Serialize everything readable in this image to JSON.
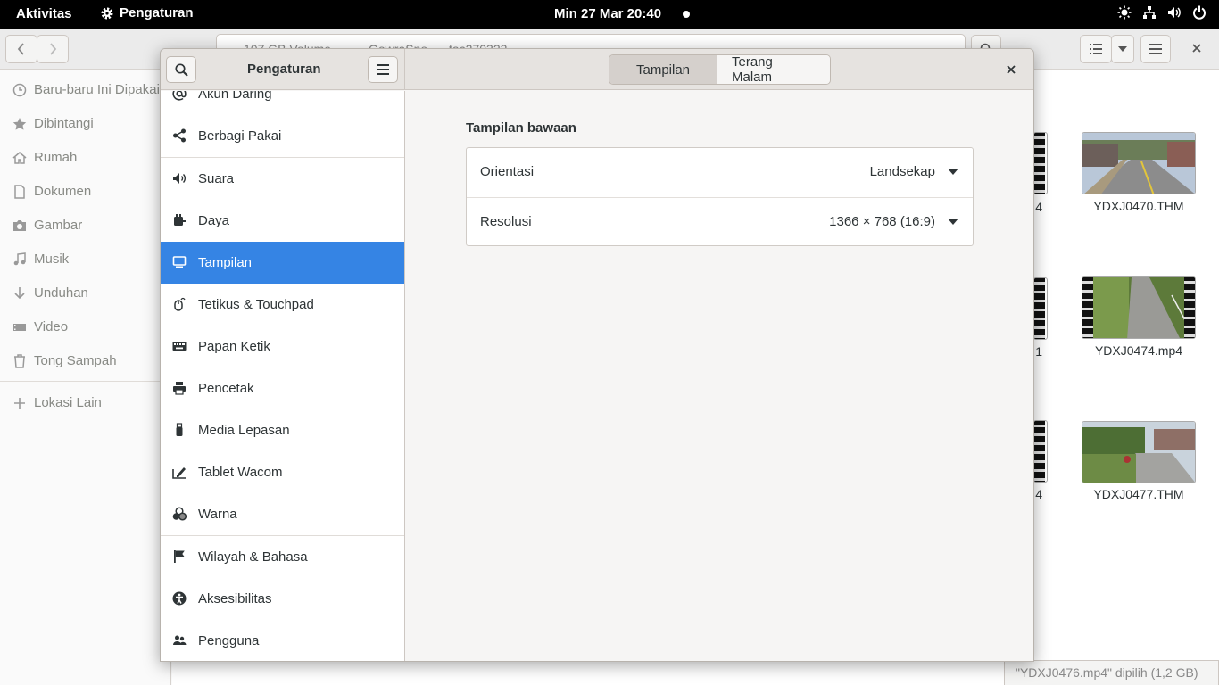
{
  "topbar": {
    "activities": "Aktivitas",
    "app_menu": "Pengaturan",
    "clock": "Min 27 Mar  20:40"
  },
  "file_manager": {
    "path_segments": [
      "107 GB Volume",
      "GowraSno",
      "tac270322"
    ],
    "sidebar": [
      {
        "label": "Baru-baru Ini Dipakai",
        "icon": "clock-icon"
      },
      {
        "label": "Dibintangi",
        "icon": "star-icon"
      },
      {
        "label": "Rumah",
        "icon": "home-icon"
      },
      {
        "label": "Dokumen",
        "icon": "document-icon"
      },
      {
        "label": "Gambar",
        "icon": "camera-icon"
      },
      {
        "label": "Musik",
        "icon": "music-icon"
      },
      {
        "label": "Unduhan",
        "icon": "download-icon"
      },
      {
        "label": "Video",
        "icon": "video-icon"
      },
      {
        "label": "Tong Sampah",
        "icon": "trash-icon"
      },
      {
        "label": "Lokasi Lain",
        "icon": "plus-icon"
      }
    ],
    "files": [
      {
        "name": "YDXJ0470.THM",
        "type": "image"
      },
      {
        "name": "YDXJ0474.mp4",
        "type": "video"
      },
      {
        "name": "YDXJ0477.THM",
        "type": "image"
      }
    ],
    "partial_labels": [
      "4",
      "1",
      "4"
    ],
    "status": "\"YDXJ0476.mp4\" dipilih  (1,2 GB)"
  },
  "settings": {
    "title": "Pengaturan",
    "tabs": [
      "Tampilan",
      "Terang Malam"
    ],
    "active_tab": "Tampilan",
    "sidebar": [
      {
        "label": "Akun Daring",
        "icon": "at-icon"
      },
      {
        "label": "Berbagi Pakai",
        "icon": "share-icon"
      },
      {
        "label": "Suara",
        "icon": "speaker-icon"
      },
      {
        "label": "Daya",
        "icon": "power-icon"
      },
      {
        "label": "Tampilan",
        "icon": "display-icon"
      },
      {
        "label": "Tetikus & Touchpad",
        "icon": "mouse-icon"
      },
      {
        "label": "Papan Ketik",
        "icon": "keyboard-icon"
      },
      {
        "label": "Pencetak",
        "icon": "printer-icon"
      },
      {
        "label": "Media Lepasan",
        "icon": "usb-icon"
      },
      {
        "label": "Tablet Wacom",
        "icon": "tablet-icon"
      },
      {
        "label": "Warna",
        "icon": "color-icon"
      },
      {
        "label": "Wilayah & Bahasa",
        "icon": "flag-icon"
      },
      {
        "label": "Aksesibilitas",
        "icon": "accessibility-icon"
      },
      {
        "label": "Pengguna",
        "icon": "users-icon"
      }
    ],
    "selected_item": "Tampilan",
    "section_title": "Tampilan bawaan",
    "rows": [
      {
        "label": "Orientasi",
        "value": "Landsekap"
      },
      {
        "label": "Resolusi",
        "value": "1366 × 768 (16:9)"
      }
    ]
  },
  "colors": {
    "accent": "#3584e4",
    "topbar": "#000000"
  }
}
